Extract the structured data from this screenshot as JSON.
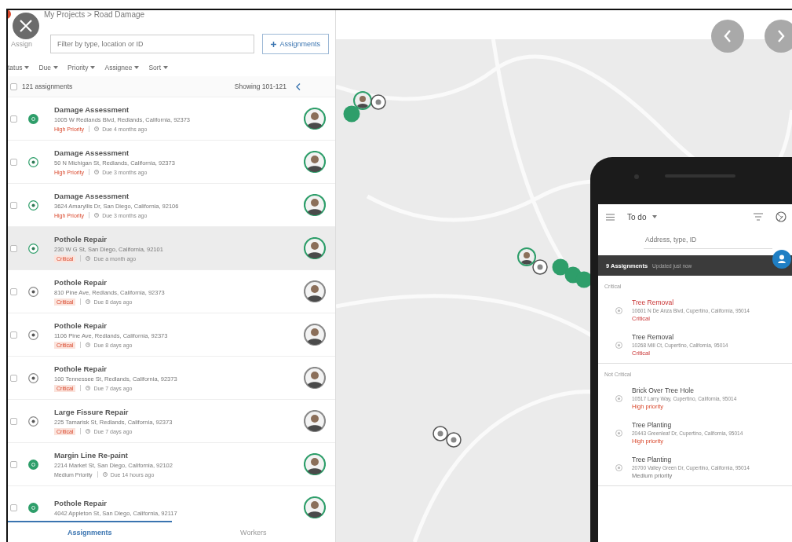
{
  "breadcrumb": "My Projects > Road Damage",
  "assign_menu": "Assign",
  "search": {
    "placeholder": "Filter by type, location or ID"
  },
  "add_button": "Assignments",
  "filters": [
    "tatus",
    "Due",
    "Priority",
    "Assignee",
    "Sort"
  ],
  "summary": {
    "checked": false,
    "count": "121 assignments",
    "range": "Showing 101-121"
  },
  "assignments": [
    {
      "kind": "completed",
      "checked": false,
      "title": "Damage Assessment",
      "address": "1005 W Redlands Blvd, Redlands, California, 92373",
      "priority": {
        "kind": "high",
        "text": "High Priority"
      },
      "due": "Due 4 months ago",
      "selected": false
    },
    {
      "kind": "in_progress",
      "checked": false,
      "title": "Damage Assessment",
      "address": "50 N Michigan St, Redlands, California, 92373",
      "priority": {
        "kind": "high",
        "text": "High Priority"
      },
      "due": "Due 3 months ago",
      "selected": false
    },
    {
      "kind": "in_progress",
      "checked": false,
      "title": "Damage Assessment",
      "address": "3624 Amaryllis Dr, San Diego, California, 92106",
      "priority": {
        "kind": "high",
        "text": "High Priority"
      },
      "due": "Due 3 months ago",
      "selected": false
    },
    {
      "kind": "in_progress",
      "checked": false,
      "title": "Pothole Repair",
      "address": "230 W G St, San Diego, California, 92101",
      "priority": {
        "kind": "critical",
        "text": "Critical"
      },
      "due": "Due a month ago",
      "selected": true
    },
    {
      "kind": "assigned",
      "checked": false,
      "title": "Pothole Repair",
      "address": "810 Pine Ave, Redlands, California, 92373",
      "priority": {
        "kind": "critical",
        "text": "Critical"
      },
      "due": "Due 8 days ago",
      "selected": false
    },
    {
      "kind": "assigned",
      "checked": false,
      "title": "Pothole Repair",
      "address": "1106 Pine Ave, Redlands, California, 92373",
      "priority": {
        "kind": "critical",
        "text": "Critical"
      },
      "due": "Due 8 days ago",
      "selected": false
    },
    {
      "kind": "assigned",
      "checked": false,
      "title": "Pothole Repair",
      "address": "100 Tennessee St, Redlands, California, 92373",
      "priority": {
        "kind": "critical",
        "text": "Critical"
      },
      "due": "Due 7 days ago",
      "selected": false
    },
    {
      "kind": "assigned",
      "checked": false,
      "title": "Large Fissure Repair",
      "address": "225 Tamarisk St, Redlands, California, 92373",
      "priority": {
        "kind": "critical",
        "text": "Critical"
      },
      "due": "Due 7 days ago",
      "selected": false
    },
    {
      "kind": "completed",
      "checked": false,
      "title": "Margin Line Re-paint",
      "address": "2214 Market St, San Diego, California, 92102",
      "priority": {
        "kind": "medium",
        "text": "Medium Priority"
      },
      "due": "Due 14 hours ago",
      "selected": false
    },
    {
      "kind": "completed",
      "checked": false,
      "title": "Pothole Repair",
      "address": "4042 Appleton St, San Diego, California, 92117",
      "selected": false
    }
  ],
  "bottom_tabs": [
    {
      "label": "Assignments",
      "selected": true
    },
    {
      "label": "Workers",
      "selected": false
    }
  ],
  "phone": {
    "title": "To do",
    "search_placeholder": "Address, type, ID",
    "banner": {
      "count": "9 Assignments",
      "updated": "Updated just now"
    },
    "sections": [
      {
        "heading": "Critical",
        "items": [
          {
            "kind": "highlighted",
            "title": "Tree Removal",
            "address": "10601 N De Anza Blvd, Cupertino, California, 95014",
            "priority": {
              "kind": "critical",
              "text": "Critical"
            }
          },
          {
            "kind": "normal",
            "title": "Tree Removal",
            "address": "10268 Mill Ct, Cupertino, California, 95014",
            "priority": {
              "kind": "critical",
              "text": "Critical"
            }
          }
        ]
      },
      {
        "heading": "Not Critical",
        "items": [
          {
            "kind": "normal",
            "title": "Brick Over Tree Hole",
            "address": "10517 Larry Way, Cupertino, California, 95014",
            "priority": {
              "kind": "high",
              "text": "High priority"
            }
          },
          {
            "kind": "normal",
            "title": "Tree Planting",
            "address": "20443 Greenleaf Dr, Cupertino, California, 95014",
            "priority": {
              "kind": "high",
              "text": "High priority"
            }
          },
          {
            "kind": "normal",
            "title": "Tree Planting",
            "address": "20700 Valley Green Dr, Cupertino, California, 95014",
            "priority": {
              "kind": "medium",
              "text": "Medium priority"
            }
          }
        ]
      }
    ]
  }
}
